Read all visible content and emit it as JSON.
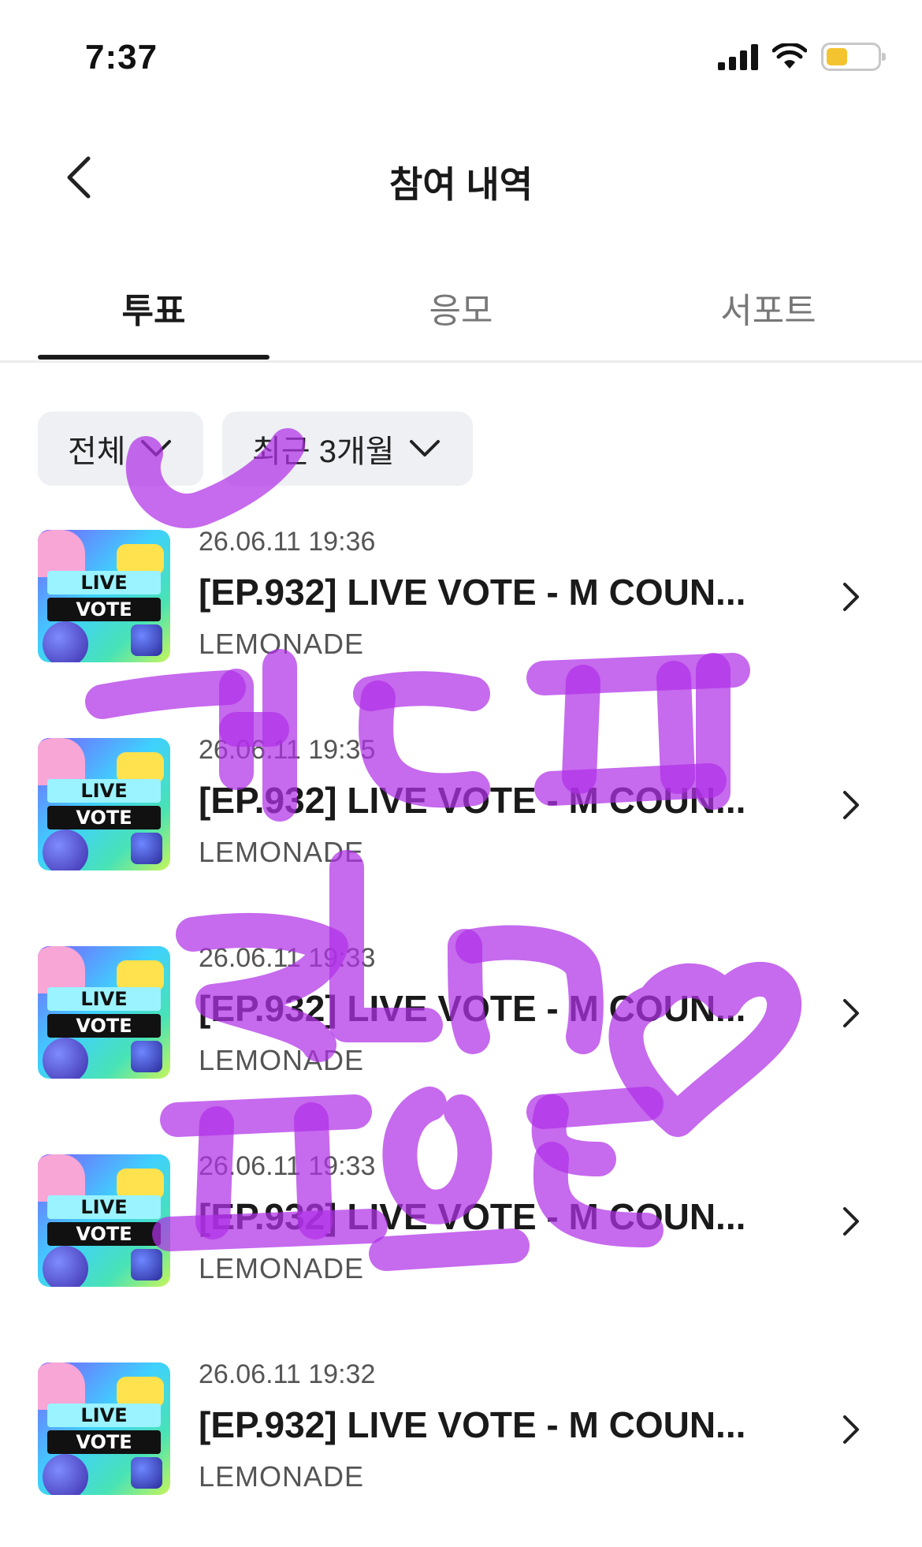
{
  "status_bar": {
    "time": "7:37",
    "icons": [
      "signal-icon",
      "wifi-icon",
      "battery-icon"
    ]
  },
  "header": {
    "title": "참여 내역",
    "back_icon": "chevron-left-icon"
  },
  "tabs": [
    {
      "label": "투표",
      "active": true
    },
    {
      "label": "응모",
      "active": false
    },
    {
      "label": "서포트",
      "active": false
    }
  ],
  "filters": {
    "type": {
      "label": "전체",
      "icon": "chevron-down-icon"
    },
    "period": {
      "label": "최근 3개월",
      "icon": "chevron-down-icon"
    }
  },
  "items": [
    {
      "date": "26.06.11 19:36",
      "title": "[EP.932] LIVE VOTE - M COUN...",
      "org": "LEMONADE",
      "thumb_text": [
        "LIVE",
        "VOTE"
      ]
    },
    {
      "date": "26.06.11 19:35",
      "title": "[EP.932] LIVE VOTE - M COUN...",
      "org": "LEMONADE",
      "thumb_text": [
        "LIVE",
        "VOTE"
      ]
    },
    {
      "date": "26.06.11 19:33",
      "title": "[EP.932] LIVE VOTE - M COUN...",
      "org": "LEMONADE",
      "thumb_text": [
        "LIVE",
        "VOTE"
      ]
    },
    {
      "date": "26.06.11 19:33",
      "title": "[EP.932] LIVE VOTE - M COUN...",
      "org": "LEMONADE",
      "thumb_text": [
        "LIVE",
        "VOTE"
      ]
    },
    {
      "date": "26.06.11 19:32",
      "title": "[EP.932] LIVE VOTE - M COUN...",
      "org": "LEMONADE",
      "thumb_text": [
        "LIVE",
        "VOTE"
      ]
    }
  ],
  "colors": {
    "scribble": "#b030e8",
    "chip_bg": "#eef0f3",
    "active_tab": "#1a1a1a",
    "battery_fill": "#f4c430"
  }
}
